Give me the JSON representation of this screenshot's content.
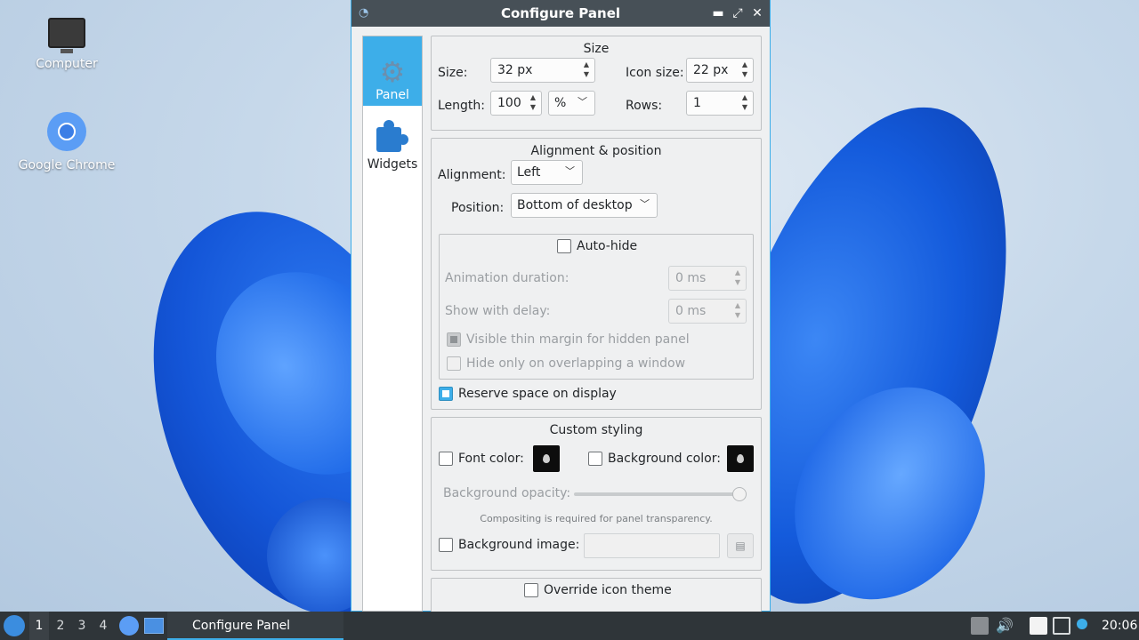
{
  "desktop": {
    "icons": [
      {
        "label": "Computer"
      },
      {
        "label": "Google Chrome"
      }
    ]
  },
  "window": {
    "title": "Configure Panel",
    "controls": {
      "minimize": "▬",
      "maximize": "⤢",
      "close": "✕"
    }
  },
  "sidebar": {
    "items": [
      {
        "label": "Panel",
        "active": true
      },
      {
        "label": "Widgets",
        "active": false
      }
    ]
  },
  "size_group": {
    "title": "Size",
    "size_label": "Size:",
    "size_value": "32 px",
    "icon_size_label": "Icon size:",
    "icon_size_value": "22 px",
    "length_label": "Length:",
    "length_value": "100",
    "length_unit": "%",
    "rows_label": "Rows:",
    "rows_value": "1"
  },
  "alignment_group": {
    "title": "Alignment & position",
    "alignment_label": "Alignment:",
    "alignment_value": "Left",
    "position_label": "Position:",
    "position_value": "Bottom of desktop",
    "autohide": {
      "label": "Auto-hide",
      "checked": false,
      "animation_label": "Animation duration:",
      "animation_value": "0 ms",
      "delay_label": "Show with delay:",
      "delay_value": "0 ms",
      "thin_margin_label": "Visible thin margin for hidden panel",
      "thin_margin_checked": true,
      "overlap_label": "Hide only on overlapping a window",
      "overlap_checked": false
    },
    "reserve_label": "Reserve space on display",
    "reserve_checked": true
  },
  "custom_group": {
    "title": "Custom styling",
    "font_color_label": "Font color:",
    "bg_color_label": "Background color:",
    "bg_opacity_label": "Background opacity:",
    "bg_opacity_value": 100,
    "compositing_note": "Compositing is required for panel transparency.",
    "bg_image_label": "Background image:",
    "bg_image_value": ""
  },
  "icon_theme": {
    "label": "Override icon theme"
  },
  "taskbar": {
    "desktops": [
      "1",
      "2",
      "3",
      "4"
    ],
    "active_desktop": "1",
    "task_label": "Configure Panel",
    "clock": "20:06"
  },
  "colors": {
    "accent": "#3daee9",
    "titlebar": "#475057",
    "taskbar": "#2f3539"
  }
}
